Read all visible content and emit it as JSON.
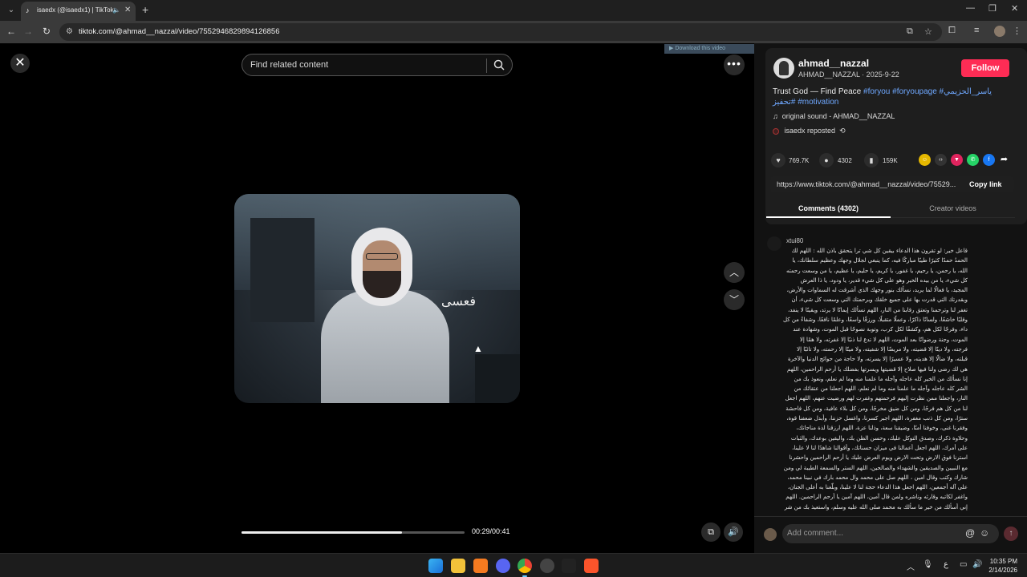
{
  "browser": {
    "tab_title": "isaedx (@isaedx1) | TikTok",
    "url": "tiktok.com/@ahmad__nazzal/video/7552946829894126856"
  },
  "page": {
    "search_placeholder": "Find related content",
    "download_badge": "▶ Download this video",
    "video_caption_overlay": "فعسى",
    "time": "00:29/00:41",
    "progress": 0.72
  },
  "author": {
    "name": "ahmad__nazzal",
    "subtitle": "AHMAD__NAZZAL · 2025-9-22",
    "follow_label": "Follow"
  },
  "description": {
    "text": "Trust God — Find Peace",
    "tags": [
      "#foryou",
      "#foryoupage",
      "#ياسر_الحزيمي",
      "#تحفيز",
      "#motivation"
    ]
  },
  "sound": "original sound - AHMAD__NAZZAL",
  "repost": "isaedx reposted",
  "stats": {
    "likes": "769.7K",
    "comments": "4302",
    "saves": "159K"
  },
  "share_link": {
    "url": "https://www.tiktok.com/@ahmad__nazzal/video/75529...",
    "copy_label": "Copy link"
  },
  "tabs": {
    "comments": "Comments (4302)",
    "creator": "Creator videos"
  },
  "comment": {
    "user": "xtui80",
    "text": "قاعل خير: لو تقرون هذا الدعاء بيقين كل شي ترا يتحقق باذن الله : اللهم لك الحمدُ حمدًا كثيرًا طيبًا مباركًا فيه، كما ينبغي لجلال وجهك وعظيم سلطانك، يا الله، يا رحمن، يا رحيم، يا غفور، يا كريم، يا حليم، يا عظيم، يا من وسعت رحمته كل شيء، يا من بيده الخير وهو على كل شيء قدير، يا ودود، يا ذا العرش المجيد، يا فعالًا لما يريد، نسألك بنور وجهك الذي أشرقت له السماوات والأرض، وبقدرتك التي قدرت بها على جميع خلقك وبرحمتك التي وسعت كل شيء، أن تغفر لنا وترحمنا وتعتق رقابنا من النار، اللهم نسألك إيمانًا لا يرتد، ويقينًا لا ينفد، وقلبًا خاشعًا، ولسانًا ذاكرًا، وعملًا متقبلًا، ورزقًا واسعًا، وعلمًا نافعًا، وشفاءً من كل داء، وفرجًا لكل هم، وكشفًا لكل كرب، وتوبة نصوحًا قبل الموت، وشهادة عند الموت، وجنة ورضوانًا بعد الموت، اللهم لا تدع لنا ذنبًا إلا غفرته، ولا همًا إلا فرجته، ولا دينًا إلا قضيته، ولا مريضًا إلا شفيته، ولا ميتًا إلا رحمته، ولا تائبًا إلا قبلته، ولا ضالًا إلا هديته، ولا عسيرًا إلا يسرته، ولا حاجة من حوائج الدنيا والآخرة هي لك رضى ولنا فيها صلاح إلا قضيتها ويسرتها بفضلك يا أرحم الراحمين، اللهم إنا نسألك من الخير كله عاجله وآجله ما علمنا منه وما لم نعلم، ونعوذ بك من الشر كله عاجله وآجله ما علمنا منه وما لم نعلم، اللهم اجعلنا من عتقائك من النار، واجعلنا ممن نظرت إليهم فرحمتهم وغفرت لهم ورضيت عنهم، اللهم اجعل لنا من كل هم فرجًا، ومن كل ضيق مخرجًا، ومن كل بلاء عافية، ومن كل فاحشة سترًا، ومن كل ذنب مغفرة، اللهم اجبر كسرنا، واغسل حزننا، وأبدل ضعفنا قوة، وفقرنا غنى، وخوفنا أمنًا، وضيقنا سعة، وذلنا عزة، اللهم ارزقنا لذة مناجاتك، وحلاوة ذكرك، وصدق التوكل عليك، وحسن الظن بك، واليقين بوعدك، والثبات على أمرك، اللهم اجعل أعمالنا في ميزان حسناتك، وأقوالنا شاهدًا لنا لا علينا، استرنا فوق الارض وتحت الارض ويوم العرض عليك يا أرحم الراحمين واحشرنا مع النبيين والصديقين والشهداء والصالحين، اللهم الستر والسمعة الطيبة لي ومن شارك وكتب وقال امين ، اللهم صل على محمد وال محمد بارك في نبينا محمد، على آله أجمعين، اللهم اجعل هذا الدعاء حجة لنا لا علينا، وبلّغنا به أعلى الجنان، واغفر لكاتبه وقارئه وناشره ولمن قال آمين، اللهم آمين يا أرحم الراحمين. اللهم إني أسألك من خير ما سألك به محمد صلى الله عليه وسلم، واستعيذ بك من شر ما استعاذ به محمد صلى الله عليه واله وال محمد اللهم ارزقنا كتب وناقل وقاريء الرسالة 💗"
  },
  "comment_bar": {
    "placeholder": "Add comment..."
  },
  "taskbar": {
    "time": "10:35 PM",
    "date": "2/14/2026"
  },
  "colors": {
    "follow": "#fe2c55",
    "hashtag": "#6fa8ff"
  }
}
